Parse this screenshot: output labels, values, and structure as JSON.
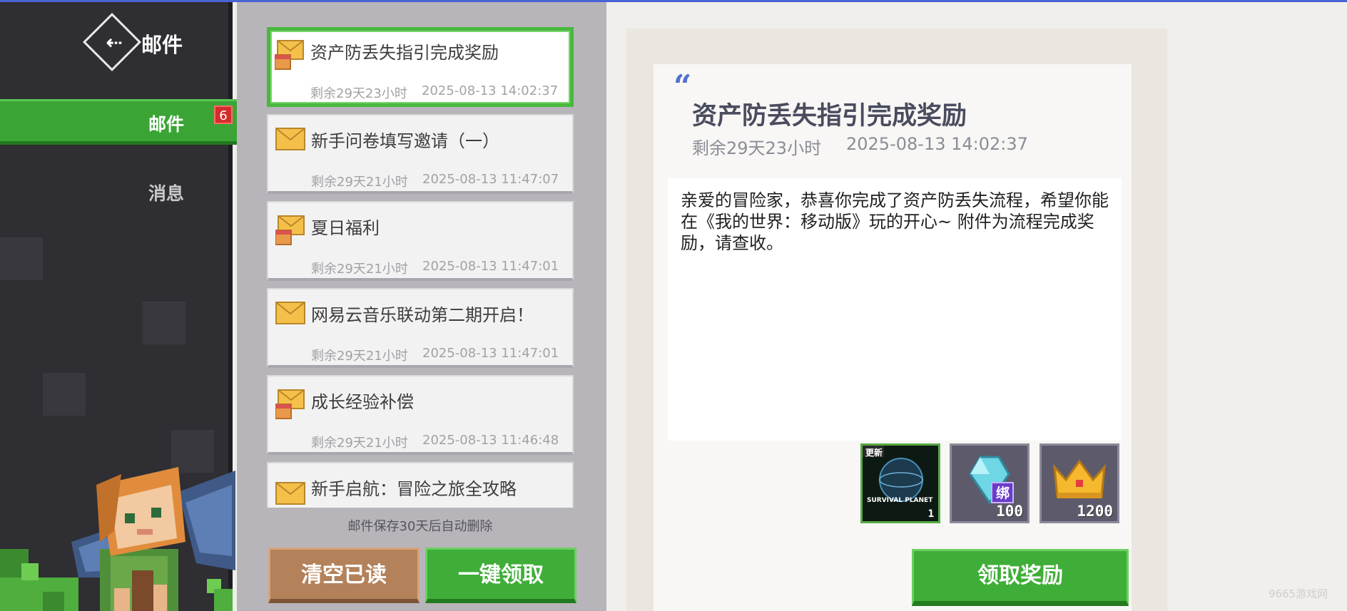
{
  "sidebar": {
    "title": "邮件",
    "tabs": [
      {
        "label": "邮件",
        "badge": "6",
        "selected": true
      },
      {
        "label": "消息",
        "selected": false
      }
    ]
  },
  "mail_list": {
    "items": [
      {
        "title": "资产防丢失指引完成奖励",
        "remain": "剩余29天23小时",
        "date": "2025-08-13 14:02:37",
        "has_attachment": true,
        "selected": true
      },
      {
        "title": "新手问卷填写邀请（一）",
        "remain": "剩余29天21小时",
        "date": "2025-08-13 11:47:07",
        "has_attachment": false
      },
      {
        "title": "夏日福利",
        "remain": "剩余29天21小时",
        "date": "2025-08-13 11:47:01",
        "has_attachment": true
      },
      {
        "title": "网易云音乐联动第二期开启！",
        "remain": "剩余29天21小时",
        "date": "2025-08-13 11:47:01",
        "has_attachment": false
      },
      {
        "title": "成长经验补偿",
        "remain": "剩余29天21小时",
        "date": "2025-08-13 11:46:48",
        "has_attachment": true
      },
      {
        "title": "新手启航：冒险之旅全攻略",
        "remain": "",
        "date": "",
        "has_attachment": false
      }
    ],
    "keep_note": "邮件保存30天后自动删除",
    "clear_read_label": "清空已读",
    "claim_all_label": "一键领取"
  },
  "detail": {
    "title": "资产防丢失指引完成奖励",
    "remain": "剩余29天23小时",
    "date": "2025-08-13 14:02:37",
    "body": "亲爱的冒险家，恭喜你完成了资产防丢失流程，希望你能在《我的世界：移动版》玩的开心~ 附件为流程完成奖励，请查收。",
    "attachments": [
      {
        "name": "survival-planet-pack",
        "tag": "更新",
        "caption": "SURVIVAL PLANET",
        "count": "1"
      },
      {
        "name": "diamond",
        "tag": "绑",
        "count": "100"
      },
      {
        "name": "crown",
        "count": "1200"
      }
    ],
    "claim_label": "领取奖励"
  },
  "watermark": "9665游戏网",
  "colors": {
    "accent_green": "#3fae38",
    "badge_red": "#d42b2b",
    "quote_blue": "#5070cf",
    "clear_brown": "#b3815a"
  }
}
